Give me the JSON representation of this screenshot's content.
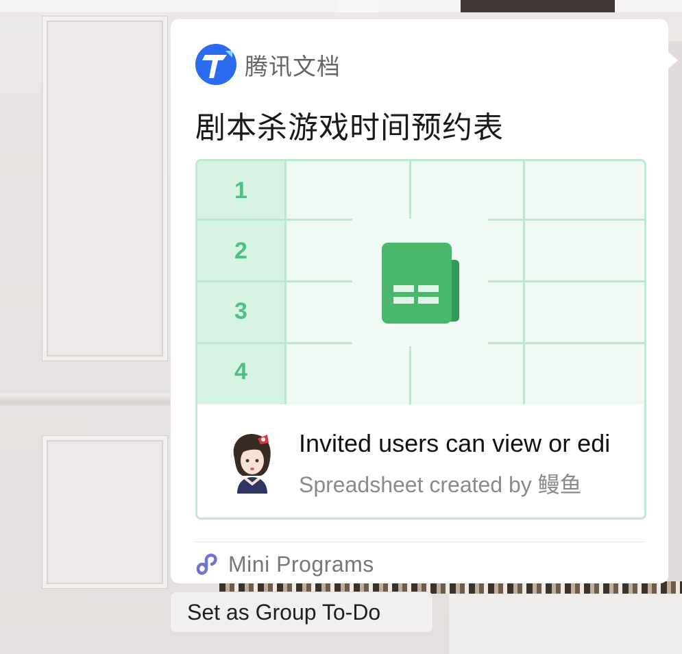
{
  "card": {
    "app_name": "腾讯文档",
    "doc_title": "剧本杀游戏时间预约表",
    "preview_rows": [
      "1",
      "2",
      "3",
      "4"
    ],
    "info_title": "Invited users can view or edi",
    "info_subtitle": "Spreadsheet created by 鳗鱼",
    "footer_label": "Mini Programs"
  },
  "action": {
    "todo_label": "Set as Group To-Do"
  },
  "icons": {
    "app_logo": "tencent-docs-logo-icon",
    "sheet": "spreadsheet-icon",
    "mini": "mini-programs-icon"
  },
  "colors": {
    "brand_blue": "#2a6bf0",
    "sheet_green": "#4cc085",
    "grid_border": "#b7ebcf"
  }
}
